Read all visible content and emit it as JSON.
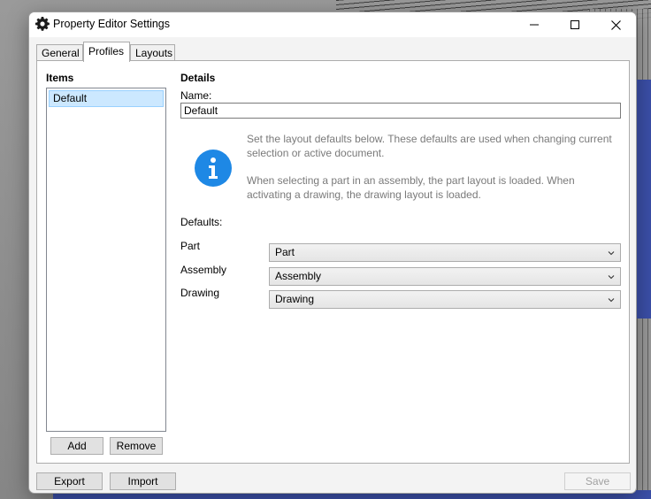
{
  "window": {
    "title": "Property Editor Settings",
    "controls": {
      "minimize": "minimize-icon",
      "maximize": "maximize-icon",
      "close": "close-icon"
    }
  },
  "tabs": [
    {
      "label": "General",
      "active": false
    },
    {
      "label": "Profiles",
      "active": true
    },
    {
      "label": "Layouts",
      "active": false
    }
  ],
  "items": {
    "heading": "Items",
    "list": [
      "Default"
    ],
    "add_label": "Add",
    "remove_label": "Remove"
  },
  "details": {
    "heading": "Details",
    "name_label": "Name:",
    "name_value": "Default",
    "info_line1": "Set the layout defaults below. These defaults are used when changing current selection or active document.",
    "info_line2": "When selecting a part in an assembly, the part layout is loaded. When activating a drawing, the drawing layout is loaded.",
    "defaults_label": "Defaults:",
    "rows": [
      {
        "label": "Part",
        "value": "Part"
      },
      {
        "label": "Assembly",
        "value": "Assembly"
      },
      {
        "label": "Drawing",
        "value": "Drawing"
      }
    ]
  },
  "footer": {
    "export_label": "Export",
    "import_label": "Import",
    "save_label": "Save"
  },
  "colors": {
    "info_blue": "#1e88e5",
    "selection": "#cce8ff"
  }
}
